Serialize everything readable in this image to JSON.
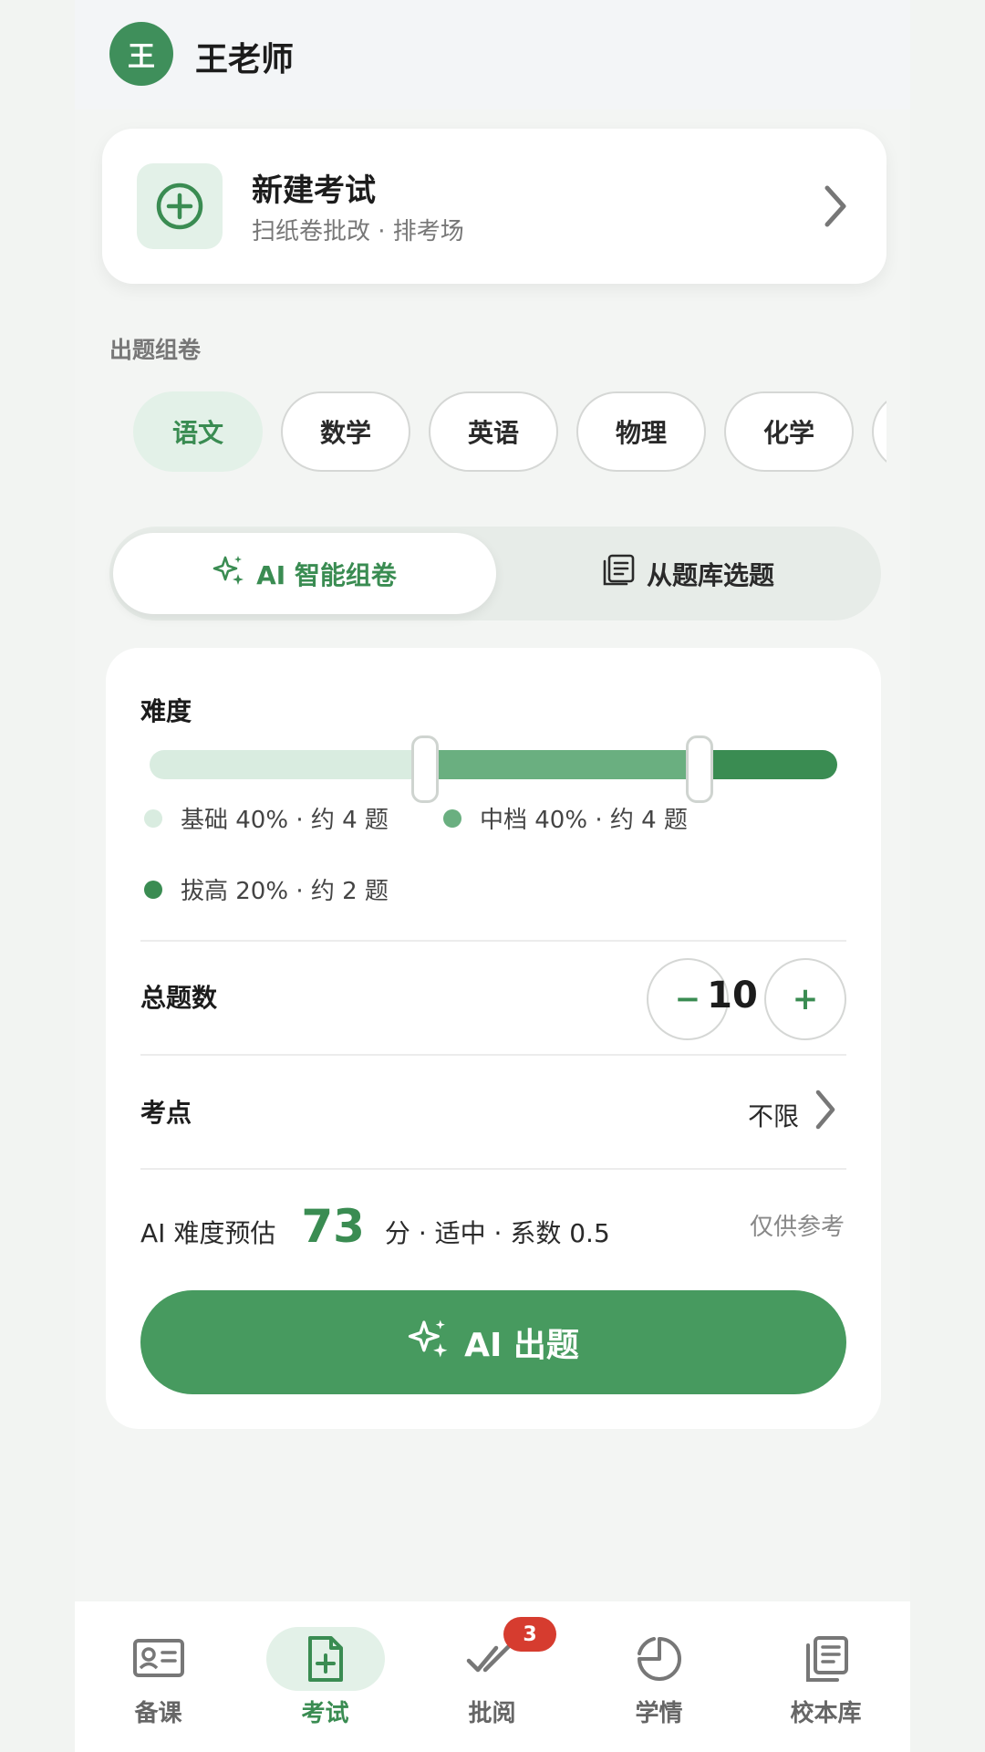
{
  "header": {
    "avatar_text": "王",
    "user_name": "王老师"
  },
  "new_exam": {
    "title": "新建考试",
    "subtitle": "扫纸卷批改 · 排考场"
  },
  "section": {
    "label": "出题组卷"
  },
  "subjects": [
    {
      "label": "语文",
      "active": true
    },
    {
      "label": "数学",
      "active": false
    },
    {
      "label": "英语",
      "active": false
    },
    {
      "label": "物理",
      "active": false
    },
    {
      "label": "化学",
      "active": false
    }
  ],
  "mode_toggle": {
    "ai_label": "AI 智能组卷",
    "bank_label": "从题库选题",
    "selected": "ai"
  },
  "difficulty": {
    "label": "难度",
    "levels": [
      {
        "text": "基础 40% · 约 4 题",
        "fraction": 0.4,
        "color": "#d9ece0"
      },
      {
        "text": "中档 40% · 约 4 题",
        "fraction": 0.4,
        "color": "#6aaf80"
      },
      {
        "text": "拔高 20% · 约 2 题",
        "fraction": 0.2,
        "color": "#3a8c52"
      }
    ]
  },
  "total": {
    "label": "总题数",
    "value": "10",
    "minus": "−",
    "plus": "+"
  },
  "points": {
    "label": "考点",
    "value": "不限"
  },
  "ai_estimate": {
    "prefix": "AI 难度预估",
    "score": "73",
    "suffix": "分 · 适中 · 系数 0.5",
    "note": "仅供参考"
  },
  "ai_button": {
    "label": "AI 出题"
  },
  "colors": {
    "brand": "#3a8c52",
    "brand_light": "#e3f1e8",
    "badge": "#d63c2f"
  },
  "nav": {
    "items": [
      {
        "label": "备课",
        "icon": "id-card-icon",
        "active": false
      },
      {
        "label": "考试",
        "icon": "file-plus-icon",
        "active": true
      },
      {
        "label": "批阅",
        "icon": "double-check-icon",
        "active": false,
        "badge": "3"
      },
      {
        "label": "学情",
        "icon": "pie-chart-icon",
        "active": false
      },
      {
        "label": "校本库",
        "icon": "book-stack-icon",
        "active": false
      }
    ]
  }
}
